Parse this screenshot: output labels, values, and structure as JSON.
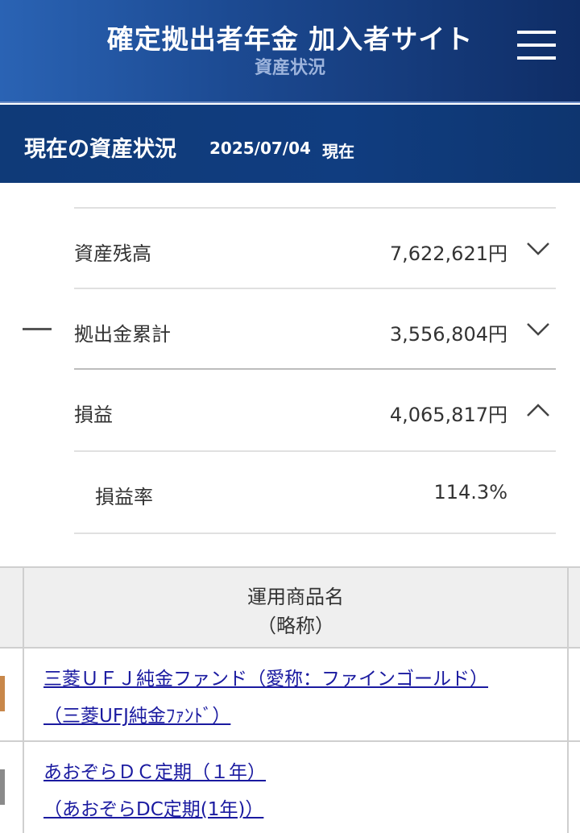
{
  "header": {
    "title": "確定拠出者年金 加入者サイト",
    "subtitle": "資産状況"
  },
  "section": {
    "title": "現在の資産状況",
    "date": "2025/07/04",
    "suffix": "現在"
  },
  "assets": [
    {
      "label": "資産残高",
      "value": "7,622,621円",
      "toggle": "chevron-down"
    },
    {
      "label": "拠出金累計",
      "value": "3,556,804円",
      "toggle": "chevron-down"
    },
    {
      "label": "損益",
      "value": "4,065,817円",
      "toggle": "chevron-up"
    },
    {
      "label": "損益率",
      "value": "114.3%"
    }
  ],
  "table": {
    "header_line1": "運用商品名",
    "header_line2": "（略称）",
    "rows": [
      {
        "name": "三菱ＵＦＪ純金ファンド（愛称：ファインゴールド）",
        "short": "（三菱UFJ純金ﾌｧﾝﾄﾞ）",
        "marker_color": "#c8874a"
      },
      {
        "name": "あおぞらＤＣ定期（１年）",
        "short": "（あおぞらDC定期(1年)）",
        "marker_color": "#8a8a8a"
      }
    ]
  }
}
